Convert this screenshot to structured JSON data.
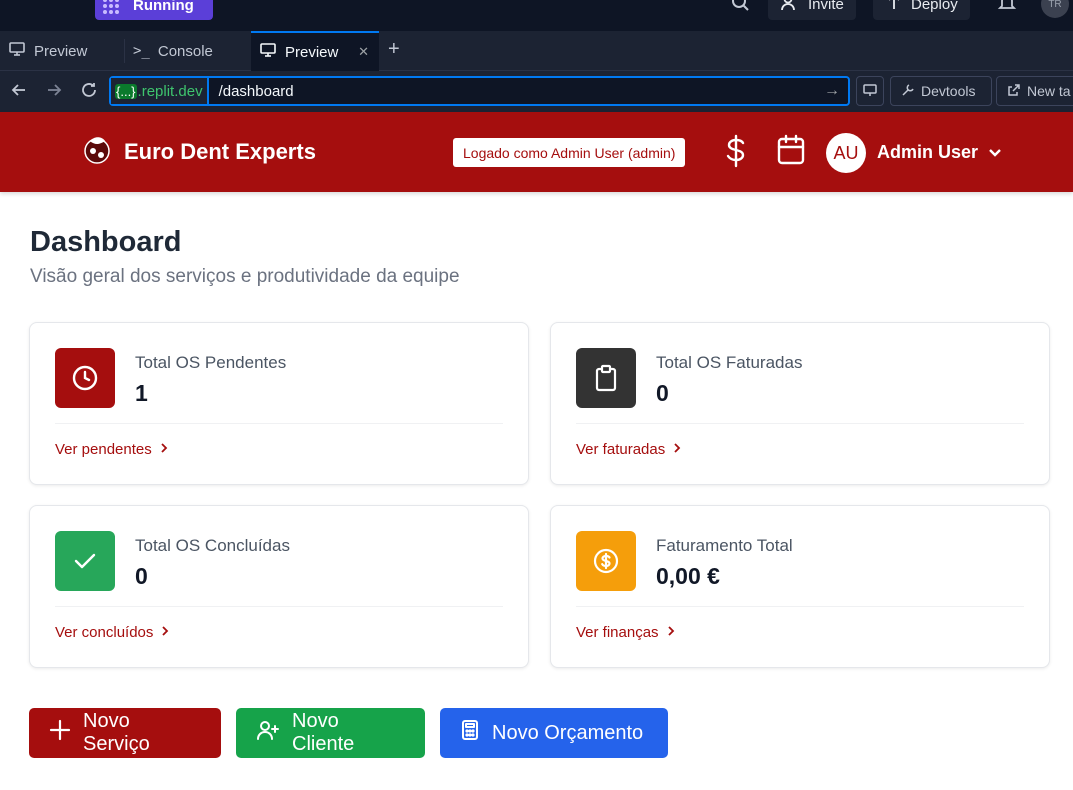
{
  "replit": {
    "status": "Running",
    "invite": "Invite",
    "deploy": "Deploy",
    "avatar": "TR"
  },
  "tabs": [
    {
      "label": "Preview"
    },
    {
      "label": "Console"
    },
    {
      "label": "Preview",
      "active": true
    }
  ],
  "urlbar": {
    "domain_brace": "{...}",
    "domain": ".replit.dev",
    "path": "/dashboard",
    "devtools": "Devtools",
    "new_tab": "New ta"
  },
  "header": {
    "brand": "Euro Dent Experts",
    "login_badge": "Logado como Admin User (admin)",
    "avatar_initials": "AU",
    "user_name": "Admin User"
  },
  "page": {
    "title": "Dashboard",
    "subtitle": "Visão geral dos serviços e produtividade da equipe"
  },
  "cards": [
    {
      "label": "Total OS Pendentes",
      "value": "1",
      "link": "Ver pendentes",
      "color": "#a50e0e",
      "icon": "clock-icon"
    },
    {
      "label": "Total OS Faturadas",
      "value": "0",
      "link": "Ver faturadas",
      "color": "#333333",
      "icon": "clipboard-icon"
    },
    {
      "label": "Total OS Concluídas",
      "value": "0",
      "link": "Ver concluídos",
      "color": "#27a75a",
      "icon": "check-icon"
    },
    {
      "label": "Faturamento Total",
      "value": "0,00 €",
      "link": "Ver finanças",
      "color": "#f59e0b",
      "icon": "dollar-circle-icon"
    }
  ],
  "actions": [
    {
      "label": "Novo Serviço",
      "color": "#a50e0e",
      "icon": "plus-icon"
    },
    {
      "label": "Novo Cliente",
      "color": "#16a34a",
      "icon": "user-plus-icon"
    },
    {
      "label": "Novo Orçamento",
      "color": "#2563eb",
      "icon": "calculator-icon"
    }
  ]
}
